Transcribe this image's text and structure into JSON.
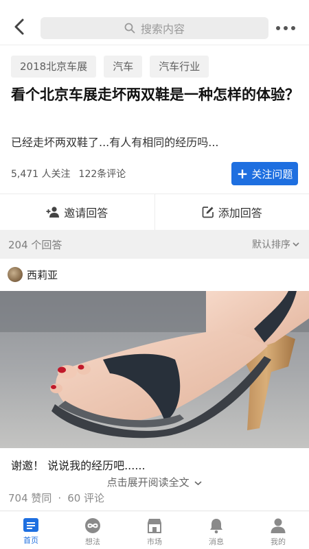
{
  "header": {
    "search_placeholder": "搜索内容"
  },
  "question": {
    "tags": [
      "2018北京车展",
      "汽车",
      "汽车行业"
    ],
    "title": "看个北京车展走坏两双鞋是一种怎样的体验？",
    "description": "已经走坏两双鞋了...有人有相同的经历吗...",
    "followers": "5,471 人关注",
    "comments": "122条评论",
    "follow_label": "关注问题"
  },
  "actions": {
    "invite_label": "邀请回答",
    "add_label": "添加回答"
  },
  "answers": {
    "count_label": "204 个回答",
    "sort_label": "默认排序"
  },
  "answer": {
    "author": "西莉亚",
    "excerpt": "谢邀！ 说说我的经历吧......",
    "expand_label": "点击展开阅读全文",
    "votes": "704 赞同",
    "comments": "60 评论"
  },
  "tabbar": {
    "items": [
      {
        "label": "首页",
        "icon": "home-icon",
        "active": true
      },
      {
        "label": "想法",
        "icon": "ideas-icon",
        "active": false
      },
      {
        "label": "市场",
        "icon": "market-icon",
        "active": false
      },
      {
        "label": "消息",
        "icon": "bell-icon",
        "active": false
      },
      {
        "label": "我的",
        "icon": "profile-icon",
        "active": false
      }
    ]
  },
  "colors": {
    "accent": "#1e6fe0",
    "muted_bg": "#f0f0f0"
  }
}
